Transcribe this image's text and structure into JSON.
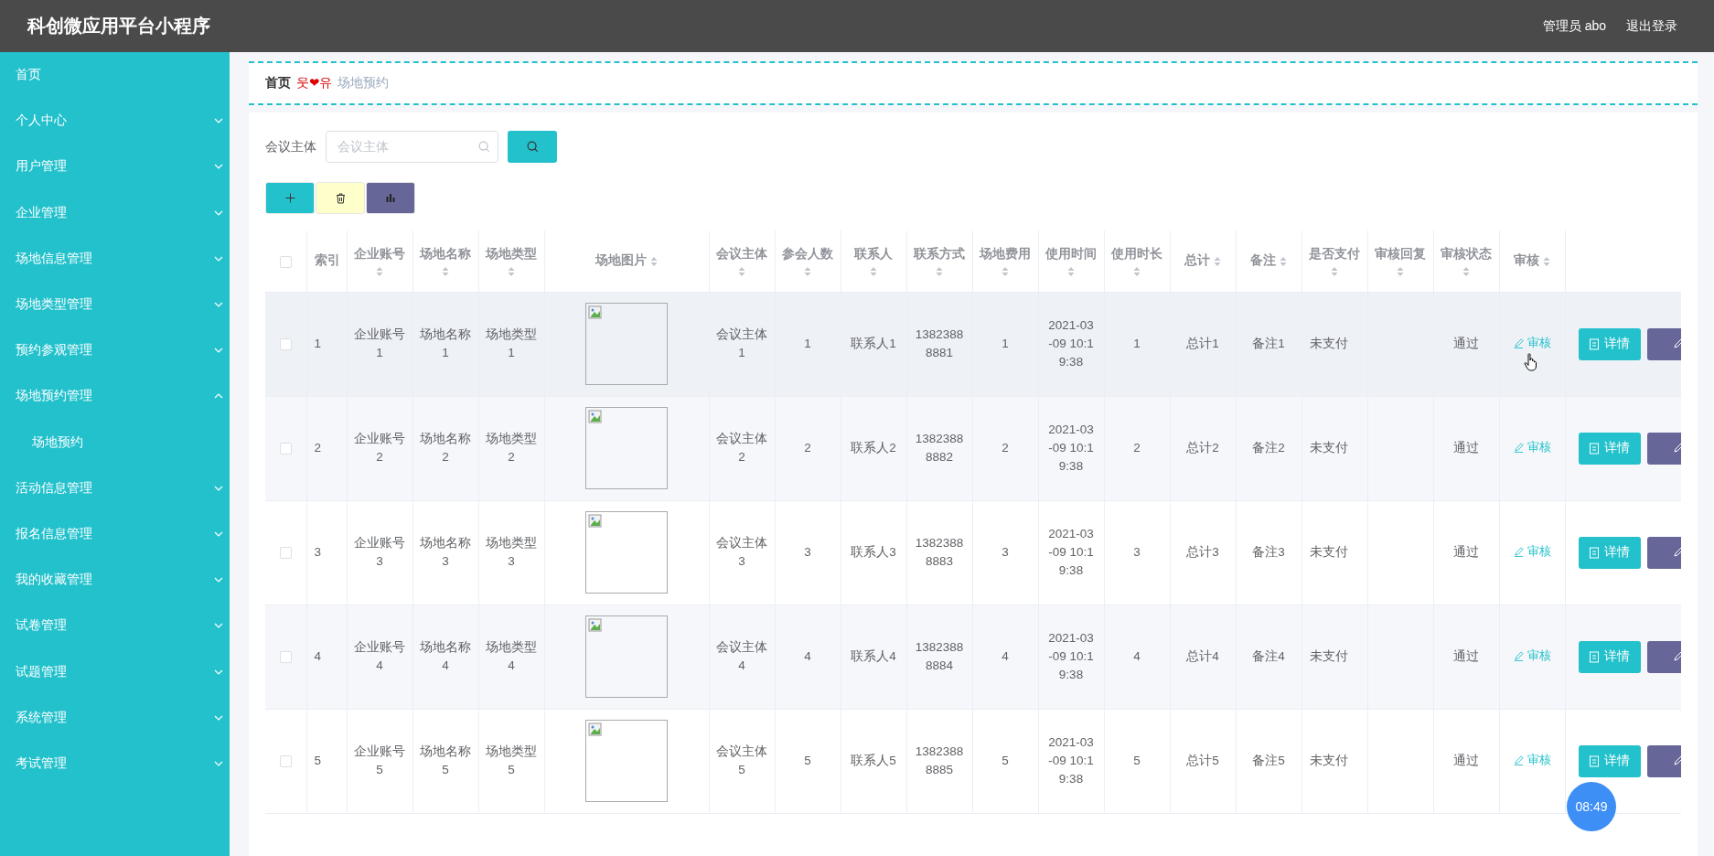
{
  "header": {
    "title": "科创微应用平台小程序",
    "user": "管理员 abo",
    "logout": "退出登录"
  },
  "sidebar": {
    "items": [
      {
        "label": "首页",
        "kind": "link"
      },
      {
        "label": "个人中心",
        "kind": "submenu",
        "expanded": false
      },
      {
        "label": "用户管理",
        "kind": "submenu",
        "expanded": false
      },
      {
        "label": "企业管理",
        "kind": "submenu",
        "expanded": false
      },
      {
        "label": "场地信息管理",
        "kind": "submenu",
        "expanded": false
      },
      {
        "label": "场地类型管理",
        "kind": "submenu",
        "expanded": false
      },
      {
        "label": "预约参观管理",
        "kind": "submenu",
        "expanded": false
      },
      {
        "label": "场地预约管理",
        "kind": "submenu",
        "expanded": true,
        "children": [
          {
            "label": "场地预约"
          }
        ]
      },
      {
        "label": "活动信息管理",
        "kind": "submenu",
        "expanded": false
      },
      {
        "label": "报名信息管理",
        "kind": "submenu",
        "expanded": false
      },
      {
        "label": "我的收藏管理",
        "kind": "submenu",
        "expanded": false
      },
      {
        "label": "试卷管理",
        "kind": "submenu",
        "expanded": false
      },
      {
        "label": "试题管理",
        "kind": "submenu",
        "expanded": false
      },
      {
        "label": "系统管理",
        "kind": "submenu",
        "expanded": false
      },
      {
        "label": "考试管理",
        "kind": "submenu",
        "expanded": false
      }
    ]
  },
  "breadcrumb": {
    "home": "首页",
    "separator": "웃❤유",
    "current": "场地预约"
  },
  "search": {
    "label": "会议主体",
    "placeholder": "会议主体"
  },
  "table": {
    "select_all_checked": false,
    "columns": [
      {
        "kind": "checkbox"
      },
      {
        "kind": "index",
        "label": "索引",
        "sortable": false
      },
      {
        "kind": "text",
        "label": "企业账号",
        "sortable": true
      },
      {
        "kind": "text",
        "label": "场地名称",
        "sortable": true
      },
      {
        "kind": "text",
        "label": "场地类型",
        "sortable": true
      },
      {
        "kind": "image",
        "label": "场地图片",
        "sortable": true
      },
      {
        "kind": "text",
        "label": "会议主体",
        "sortable": true
      },
      {
        "kind": "text",
        "label": "参会人数",
        "sortable": true
      },
      {
        "kind": "text",
        "label": "联系人",
        "sortable": true
      },
      {
        "kind": "text",
        "label": "联系方式",
        "sortable": true
      },
      {
        "kind": "text",
        "label": "场地费用",
        "sortable": true
      },
      {
        "kind": "text",
        "label": "使用时间",
        "sortable": true
      },
      {
        "kind": "text",
        "label": "使用时长",
        "sortable": true
      },
      {
        "kind": "text",
        "label": "总计",
        "sortable": true
      },
      {
        "kind": "text",
        "label": "备注",
        "sortable": true
      },
      {
        "kind": "text",
        "label": "是否支付",
        "sortable": true
      },
      {
        "kind": "blank",
        "label": "审核回复",
        "sortable": true
      },
      {
        "kind": "text",
        "label": "审核状态",
        "sortable": true
      },
      {
        "kind": "link",
        "label": "审核",
        "sortable": true
      },
      {
        "kind": "actions"
      }
    ],
    "rows": [
      {
        "checked": false,
        "hovered": true,
        "index": "1",
        "values": [
          "企业账号1",
          "场地名称1",
          "场地类型1",
          "会议主体1",
          "1",
          "联系人1",
          "13823888881",
          "1",
          "2021-03-09 10:19:38",
          "1",
          "总计1",
          "备注1",
          "未支付",
          "通过"
        ],
        "review": "审核",
        "actions": [
          {
            "kind": "detail",
            "label": "详情"
          },
          {
            "kind": "edit"
          }
        ]
      },
      {
        "checked": false,
        "hovered": false,
        "index": "2",
        "values": [
          "企业账号2",
          "场地名称2",
          "场地类型2",
          "会议主体2",
          "2",
          "联系人2",
          "13823888882",
          "2",
          "2021-03-09 10:19:38",
          "2",
          "总计2",
          "备注2",
          "未支付",
          "通过"
        ],
        "review": "审核",
        "actions": [
          {
            "kind": "detail",
            "label": "详情"
          },
          {
            "kind": "edit"
          }
        ]
      },
      {
        "checked": false,
        "hovered": false,
        "index": "3",
        "values": [
          "企业账号3",
          "场地名称3",
          "场地类型3",
          "会议主体3",
          "3",
          "联系人3",
          "13823888883",
          "3",
          "2021-03-09 10:19:38",
          "3",
          "总计3",
          "备注3",
          "未支付",
          "通过"
        ],
        "review": "审核",
        "actions": [
          {
            "kind": "detail",
            "label": "详情"
          },
          {
            "kind": "edit"
          }
        ]
      },
      {
        "checked": false,
        "hovered": false,
        "index": "4",
        "values": [
          "企业账号4",
          "场地名称4",
          "场地类型4",
          "会议主体4",
          "4",
          "联系人4",
          "13823888884",
          "4",
          "2021-03-09 10:19:38",
          "4",
          "总计4",
          "备注4",
          "未支付",
          "通过"
        ],
        "review": "审核",
        "actions": [
          {
            "kind": "detail",
            "label": "详情"
          },
          {
            "kind": "edit"
          }
        ]
      },
      {
        "checked": false,
        "hovered": false,
        "index": "5",
        "values": [
          "企业账号5",
          "场地名称5",
          "场地类型5",
          "会议主体5",
          "5",
          "联系人5",
          "13823888885",
          "5",
          "2021-03-09 10:19:38",
          "5",
          "总计5",
          "备注5",
          "未支付",
          "通过"
        ],
        "review": "审核",
        "actions": [
          {
            "kind": "detail",
            "label": "详情"
          },
          {
            "kind": "edit"
          }
        ]
      }
    ]
  },
  "clock_badge": "08:49"
}
